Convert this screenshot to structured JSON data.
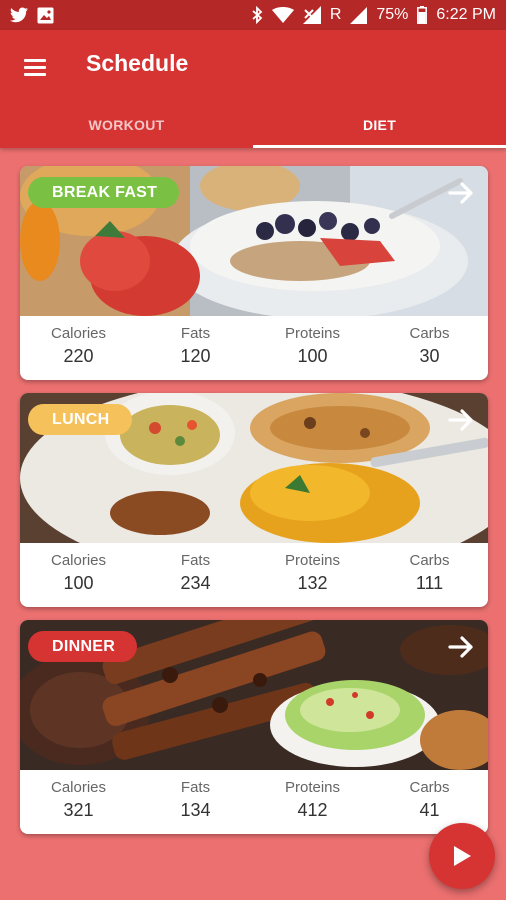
{
  "status_bar": {
    "battery": "75%",
    "time": "6:22 PM",
    "roaming": "R",
    "icons": [
      "twitter-icon",
      "image-icon",
      "bluetooth-icon",
      "wifi-icon",
      "no-signal-icon",
      "signal-icon",
      "battery-icon"
    ]
  },
  "app_bar": {
    "title": "Schedule",
    "menu_icon": "hamburger-menu-icon"
  },
  "tabs": [
    {
      "label": "WORKOUT",
      "active": false
    },
    {
      "label": "DIET",
      "active": true
    }
  ],
  "meals": [
    {
      "name": "BREAK FAST",
      "badge_color": "#7ac143",
      "stats": [
        {
          "label": "Calories",
          "value": "220"
        },
        {
          "label": "Fats",
          "value": "120"
        },
        {
          "label": "Proteins",
          "value": "100"
        },
        {
          "label": "Carbs",
          "value": "30"
        }
      ]
    },
    {
      "name": "LUNCH",
      "badge_color": "#f5c15a",
      "stats": [
        {
          "label": "Calories",
          "value": "100"
        },
        {
          "label": "Fats",
          "value": "234"
        },
        {
          "label": "Proteins",
          "value": "132"
        },
        {
          "label": "Carbs",
          "value": "111"
        }
      ]
    },
    {
      "name": "DINNER",
      "badge_color": "#d63333",
      "stats": [
        {
          "label": "Calories",
          "value": "321"
        },
        {
          "label": "Fats",
          "value": "134"
        },
        {
          "label": "Proteins",
          "value": "412"
        },
        {
          "label": "Carbs",
          "value": "41"
        }
      ]
    }
  ],
  "colors": {
    "background": "#ec7070",
    "app_bar": "#d63333",
    "status_bar": "#b52828",
    "fab": "#d63333"
  },
  "fab_icon": "play-icon",
  "card_arrow_icon": "arrow-right-icon"
}
